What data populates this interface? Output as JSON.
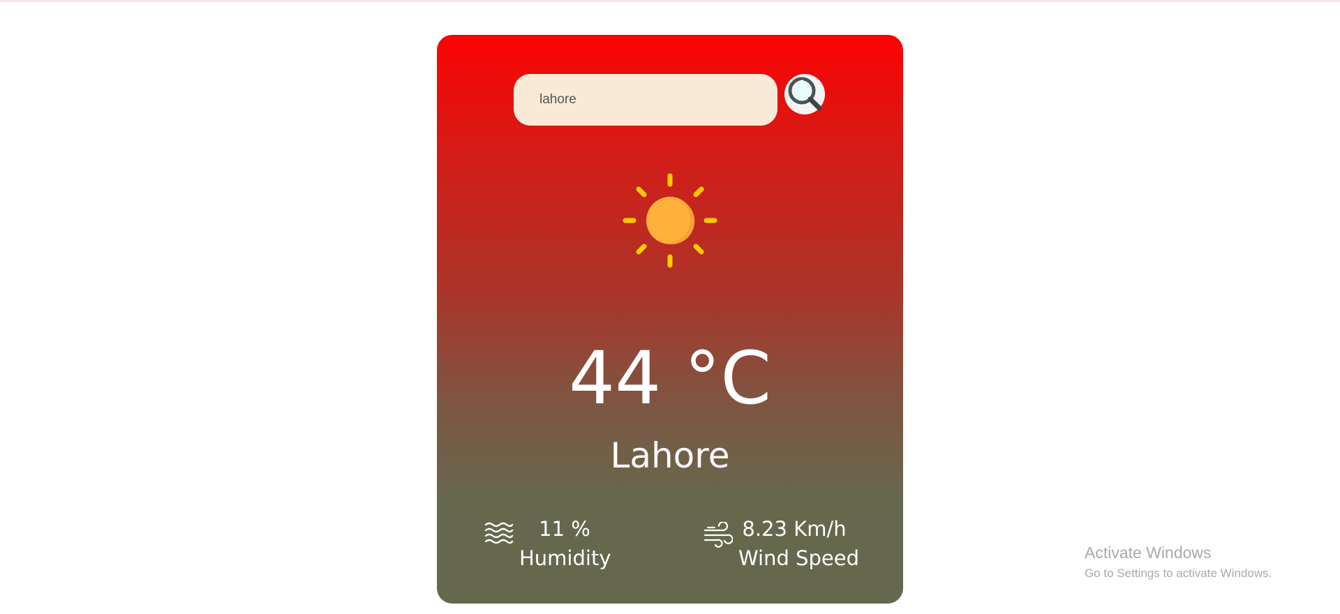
{
  "search": {
    "value": "lahore",
    "button_icon": "search-magnifier-icon"
  },
  "weather": {
    "icon": "sun-icon",
    "temperature": "44 °C",
    "city": "Lahore"
  },
  "details": {
    "humidity": {
      "icon": "humidity-waves-icon",
      "value": "11 %",
      "label": "Humidity"
    },
    "wind": {
      "icon": "wind-icon",
      "value": "8.23 Km/h",
      "label": "Wind Speed"
    }
  },
  "watermark": {
    "title": "Activate Windows",
    "subtitle": "Go to Settings to activate Windows."
  },
  "colors": {
    "card_top": "#fb0303",
    "card_bottom": "#66684d",
    "input_bg": "#f9ead7",
    "sun_rays": "#ffcc00",
    "sun_body": "#ffb03a"
  }
}
